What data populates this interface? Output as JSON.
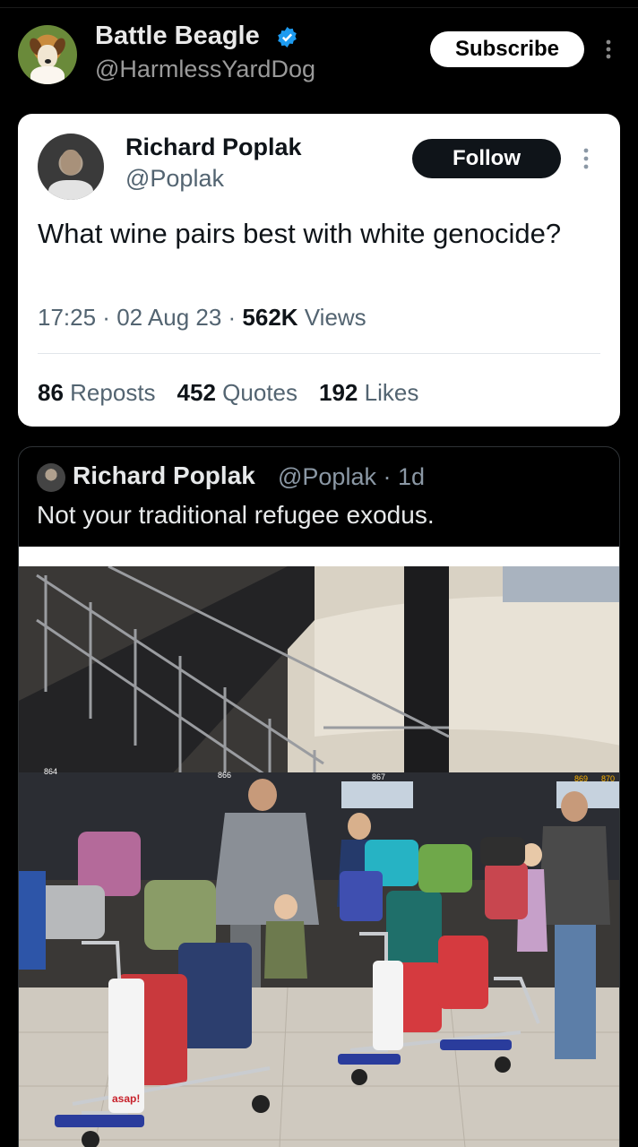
{
  "header": {
    "name": "Battle Beagle",
    "handle": "@HarmlessYardDog",
    "subscribe_label": "Subscribe",
    "avatar_icon": "beagle-avatar",
    "verified_icon": "verified-badge-icon"
  },
  "embedded_tweet": {
    "author_name": "Richard Poplak",
    "author_handle": "@Poplak",
    "follow_label": "Follow",
    "text": "What wine pairs best with white genocide?",
    "time": "17:25",
    "sep1": " · ",
    "date": "02 Aug 23",
    "sep2": " · ",
    "views_count": "562K",
    "views_label": " Views",
    "reposts_count": "86",
    "reposts_label": "Reposts",
    "quotes_count": "452",
    "quotes_label": "Quotes",
    "likes_count": "192",
    "likes_label": "Likes"
  },
  "quoted_tweet": {
    "author_name": "Richard Poplak",
    "author_handle": "@Poplak",
    "time": "· 1d",
    "text": "Not your traditional refugee exodus.",
    "photo_icon": "airport-luggage-photo",
    "photo_signs": {
      "gate_left": "864",
      "gate_mid": "866",
      "gate_right1": "869",
      "gate_right2": "870",
      "gate_center": "867",
      "trolley_brand": "asap!"
    }
  },
  "colors": {
    "background": "#000000",
    "card_bg": "#ffffff",
    "verified_blue": "#1d9bf0",
    "follow_bg": "#0f1419"
  }
}
